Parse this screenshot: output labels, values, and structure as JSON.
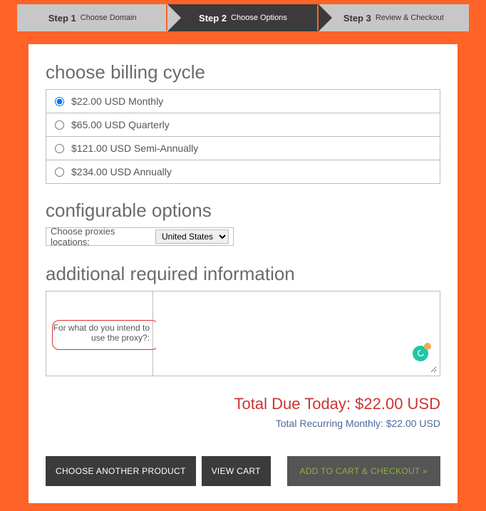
{
  "stepper": {
    "steps": [
      {
        "num": "Step 1",
        "label": "Choose Domain"
      },
      {
        "num": "Step 2",
        "label": "Choose Options"
      },
      {
        "num": "Step 3",
        "label": "Review & Checkout"
      }
    ]
  },
  "sections": {
    "billing_title": "choose billing cycle",
    "config_title": "configurable options",
    "info_title": "additional required information"
  },
  "billing": {
    "options": [
      {
        "label": "$22.00 USD Monthly",
        "selected": true
      },
      {
        "label": "$65.00 USD Quarterly",
        "selected": false
      },
      {
        "label": "$121.00 USD Semi-Annually",
        "selected": false
      },
      {
        "label": "$234.00 USD Annually",
        "selected": false
      }
    ]
  },
  "config": {
    "proxies_label": "Choose proxies locations:",
    "proxies_selected": "United States",
    "proxies_options": [
      "United States"
    ]
  },
  "info": {
    "question": "For what do you intend to use the proxy?:",
    "value": ""
  },
  "totals": {
    "due_label": "Total Due Today: ",
    "due_amount": "$22.00 USD",
    "recurring_label": "Total Recurring Monthly: ",
    "recurring_amount": "$22.00 USD"
  },
  "actions": {
    "choose_another": "CHOOSE ANOTHER PRODUCT",
    "view_cart": "VIEW CART",
    "checkout": "ADD TO CART & CHECKOUT »"
  }
}
